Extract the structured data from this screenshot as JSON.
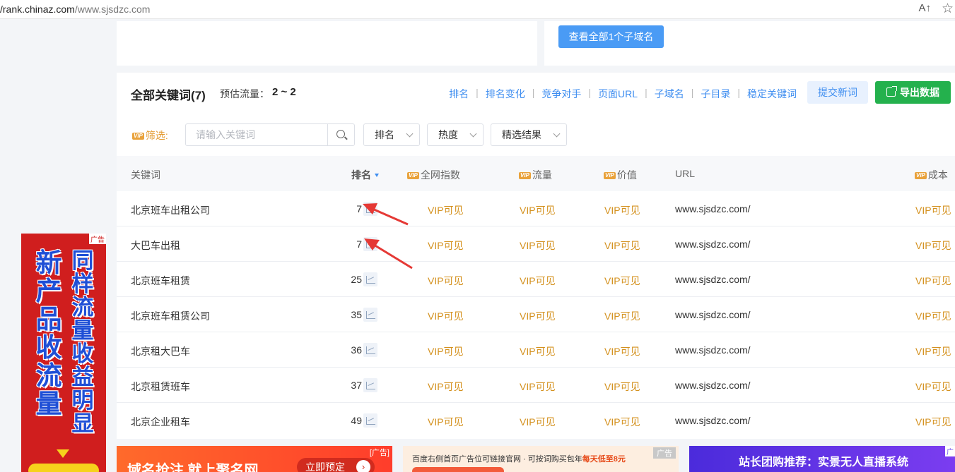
{
  "browser": {
    "url_host": "/rank.chinaz.com",
    "url_path": "/www.sjsdzc.com",
    "read_aloud_icon": "A↑",
    "favorite_icon": "☆"
  },
  "subdomain_button": "查看全部1个子域名",
  "header": {
    "title": "全部关键词(7)",
    "traffic_label": "预估流量：",
    "traffic_value": "2 ~ 2",
    "links": [
      "排名",
      "排名变化",
      "竞争对手",
      "页面URL",
      "子域名",
      "子目录",
      "稳定关键词"
    ],
    "submit_new": "提交新词",
    "export": "导出数据"
  },
  "filter": {
    "vip_badge": "VIP",
    "label": "筛选:",
    "search_placeholder": "请输入关键词",
    "dropdowns": [
      "排名",
      "热度",
      "精选结果"
    ]
  },
  "table": {
    "columns": {
      "keyword": "关键词",
      "rank": "排名",
      "index": "全网指数",
      "flow": "流量",
      "value": "价值",
      "url": "URL",
      "cost": "成本"
    },
    "rows": [
      {
        "keyword": "北京班车出租公司",
        "rank": "7",
        "index": "VIP可见",
        "flow": "VIP可见",
        "value": "VIP可见",
        "url": "www.sjsdzc.com/",
        "cost": "VIP可见"
      },
      {
        "keyword": "大巴车出租",
        "rank": "7",
        "index": "VIP可见",
        "flow": "VIP可见",
        "value": "VIP可见",
        "url": "www.sjsdzc.com/",
        "cost": "VIP可见"
      },
      {
        "keyword": "北京班车租赁",
        "rank": "25",
        "index": "VIP可见",
        "flow": "VIP可见",
        "value": "VIP可见",
        "url": "www.sjsdzc.com/",
        "cost": "VIP可见"
      },
      {
        "keyword": "北京班车租赁公司",
        "rank": "35",
        "index": "VIP可见",
        "flow": "VIP可见",
        "value": "VIP可见",
        "url": "www.sjsdzc.com/",
        "cost": "VIP可见"
      },
      {
        "keyword": "北京租大巴车",
        "rank": "36",
        "index": "VIP可见",
        "flow": "VIP可见",
        "value": "VIP可见",
        "url": "www.sjsdzc.com/",
        "cost": "VIP可见"
      },
      {
        "keyword": "北京租赁班车",
        "rank": "37",
        "index": "VIP可见",
        "flow": "VIP可见",
        "value": "VIP可见",
        "url": "www.sjsdzc.com/",
        "cost": "VIP可见"
      },
      {
        "keyword": "北京企业租车",
        "rank": "49",
        "index": "VIP可见",
        "flow": "VIP可见",
        "value": "VIP可见",
        "url": "www.sjsdzc.com/",
        "cost": "VIP可见"
      }
    ]
  },
  "annotation_color": "#e53935",
  "ads": {
    "vertical": {
      "tag": "广告",
      "col_a": "新产品收流量",
      "col_b": "同样流量收益明显"
    },
    "banner1": {
      "text": "域名抢注 就上聚名网",
      "cta": "立即预定",
      "tag": "[广告]"
    },
    "banner2": {
      "text_a": "百度右侧首页广告位可链接官网 · 可按词购买包年",
      "text_hl": "每天低至8元",
      "tag": "广告"
    },
    "banner3": {
      "text": "站长团购推荐：实景无人直播系统",
      "tag": "广"
    }
  }
}
